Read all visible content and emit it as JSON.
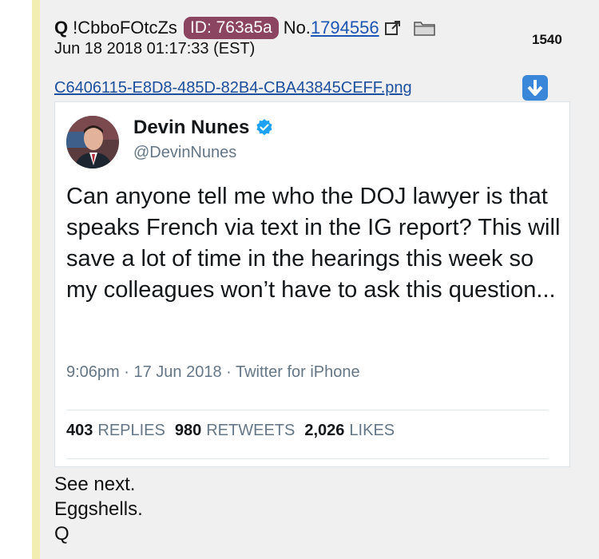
{
  "post": {
    "name": "Q",
    "tripcode": "!CbboFOtcZs",
    "id_badge": "ID: 763a5a",
    "no_label": "No.",
    "post_number": "1794556",
    "date": "Jun 18 2018 01:17:33 (EST)",
    "index": "1540",
    "filename": "C6406115-E8D8-485D-82B4-CBA43845CEFF.png",
    "message_lines": [
      "See next.",
      "Eggshells.",
      "Q"
    ]
  },
  "tweet": {
    "display_name": "Devin Nunes",
    "handle": "@DevinNunes",
    "text": "Can anyone tell me who the DOJ lawyer is that speaks French via text in the IG report?  This will save a lot of time in the hearings this week so my colleagues won’t have to ask this question...",
    "timestamp": "9:06pm · 17 Jun 2018 · Twitter for iPhone",
    "replies_count": "403",
    "replies_label": "REPLIES",
    "retweets_count": "980",
    "retweets_label": "RETWEETS",
    "likes_count": "2,026",
    "likes_label": "LIKES"
  },
  "colors": {
    "post_background": "#f0f0f0",
    "post_accent": "#f2edb0",
    "id_badge": "#8b4560",
    "link": "#1d55b3",
    "verified": "#1da1f2",
    "download_icon": "#3a86d9"
  },
  "icons": [
    "external-link-icon",
    "folder-icon",
    "download-icon",
    "verified-icon"
  ]
}
